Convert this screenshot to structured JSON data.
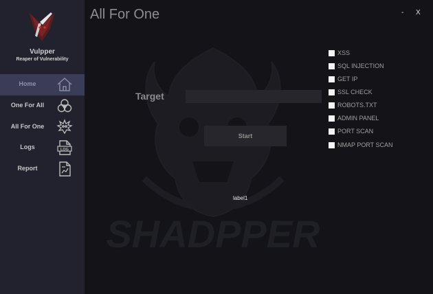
{
  "brand": {
    "name": "Vulpper",
    "tagline": "Reaper of Vulnerability"
  },
  "sidebar": {
    "items": [
      {
        "label": "Home",
        "icon": "home-icon",
        "active": true
      },
      {
        "label": "One For All",
        "icon": "biohazard-icon",
        "active": false
      },
      {
        "label": "All For One",
        "icon": "spiky-skull-icon",
        "active": false
      },
      {
        "label": "Logs",
        "icon": "log-file-icon",
        "active": false
      },
      {
        "label": "Report",
        "icon": "report-document-icon",
        "active": false
      }
    ]
  },
  "window": {
    "title": "All For One",
    "minimize_label": "-",
    "close_label": "X"
  },
  "form": {
    "target_label": "Target",
    "target_value": "",
    "start_label": "Start",
    "status_label": "label1"
  },
  "background_art": {
    "text": "SHADPPER"
  },
  "options": [
    {
      "label": "XSS",
      "checked": false
    },
    {
      "label": "SQL INJECTION",
      "checked": false
    },
    {
      "label": "GET IP",
      "checked": false
    },
    {
      "label": "SSL CHECK",
      "checked": false
    },
    {
      "label": "ROBOTS.TXT",
      "checked": false
    },
    {
      "label": "ADMIN PANEL",
      "checked": false
    },
    {
      "label": "PORT SCAN",
      "checked": false
    },
    {
      "label": "NMAP PORT SCAN",
      "checked": false
    }
  ],
  "colors": {
    "background": "#131318",
    "sidebar": "#22222e",
    "active_nav": "#3b3c55",
    "logo_red": "#7a2323"
  }
}
